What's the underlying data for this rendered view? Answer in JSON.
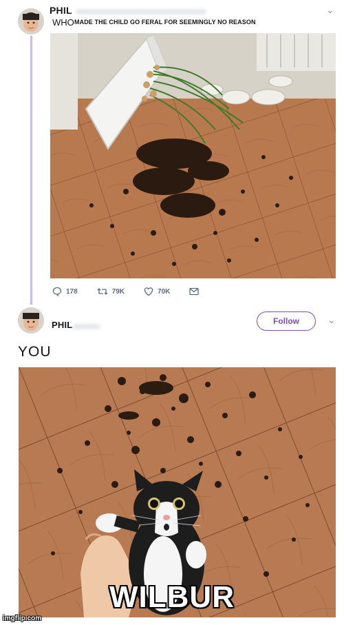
{
  "tweet": {
    "author": "PHIL",
    "prefix": "WHO",
    "caption": "MADE THE CHILD GO FERAL FOR SEEMINGLY NO REASON",
    "actions": {
      "replies": "178",
      "retweets": "79K",
      "likes": "70K"
    }
  },
  "reply": {
    "author": "PHIL",
    "follow_label": "Follow",
    "text": "YOU"
  },
  "meme": {
    "caption": "WILBUR",
    "watermark": "imgflip.com"
  },
  "colors": {
    "accent": "#794bc4",
    "thread_line": "#cbb7f2",
    "icon_gray": "#5b6b7a"
  }
}
